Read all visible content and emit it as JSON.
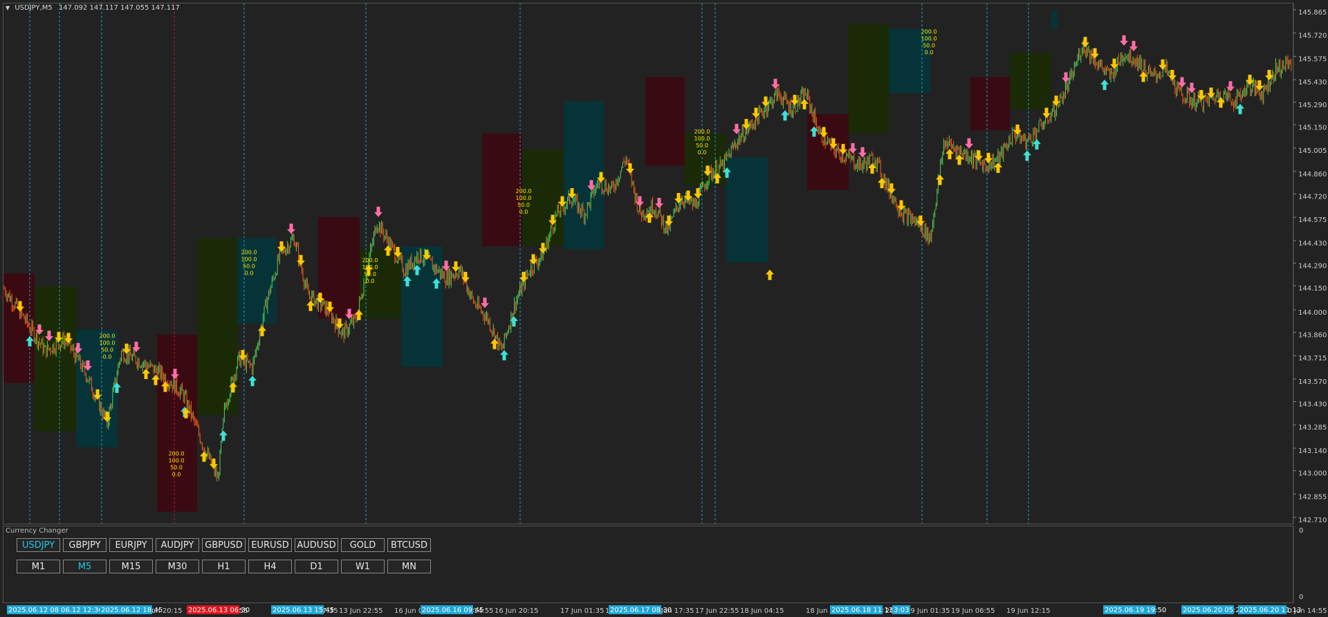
{
  "symbol": {
    "name": "USDJPY,M5",
    "ohlc": "147.092 147.117 147.055 147.117"
  },
  "colors": {
    "background": "#222222",
    "bull_candle": "#56d35a",
    "bear_candle": "#ff5a1a",
    "zone_red": "#3a0a12",
    "zone_green": "#1a2a06",
    "zone_teal": "#063338",
    "arrow_yellow": "#ffc800",
    "arrow_pink": "#ff6ea8",
    "arrow_cyan": "#3ee0d6",
    "grid_vline": "#1ea7d6",
    "accent": "#22c8e6"
  },
  "price_axis": {
    "labels": [
      "145.865",
      "145.720",
      "145.575",
      "145.430",
      "145.290",
      "145.150",
      "145.005",
      "144.860",
      "144.720",
      "144.575",
      "144.430",
      "144.290",
      "144.150",
      "144.000",
      "143.860",
      "143.715",
      "143.570",
      "143.430",
      "143.285",
      "143.140",
      "143.000",
      "142.855",
      "142.710"
    ]
  },
  "sub_axis": {
    "top": "0",
    "bottom": "0"
  },
  "panel": {
    "title": "Currency Changer"
  },
  "pairs": [
    {
      "label": "USDJPY",
      "active": true
    },
    {
      "label": "GBPJPY",
      "active": false
    },
    {
      "label": "EURJPY",
      "active": false
    },
    {
      "label": "AUDJPY",
      "active": false
    },
    {
      "label": "GBPUSD",
      "active": false
    },
    {
      "label": "EURUSD",
      "active": false
    },
    {
      "label": "AUDUSD",
      "active": false
    },
    {
      "label": "GOLD",
      "active": false
    },
    {
      "label": "BTCUSD",
      "active": false
    }
  ],
  "timeframes": [
    {
      "label": "M1",
      "active": false
    },
    {
      "label": "M5",
      "active": true
    },
    {
      "label": "M15",
      "active": false
    },
    {
      "label": "M30",
      "active": false
    },
    {
      "label": "H1",
      "active": false
    },
    {
      "label": "H4",
      "active": false
    },
    {
      "label": "D1",
      "active": false
    },
    {
      "label": "W1",
      "active": false
    },
    {
      "label": "MN",
      "active": false
    }
  ],
  "time_axis": {
    "labels": [
      "12 Jun 20:15",
      "13 Jun 06:55",
      "13 Jun 17:35",
      "13 Jun 22:55",
      "16 Jun 04:15",
      "16 Jun 14:55",
      "16 Jun 20:15",
      "17 Jun 01:35",
      "17 Jun 12:15",
      "17 Jun 17:35",
      "17 Jun 22:55",
      "18 Jun 04:15",
      "18 Jun 14:55",
      "18 Jun 20:15",
      "19 Jun 01:35",
      "19 Jun 06:55",
      "19 Jun 12:15",
      "19 Jun 22:55",
      "20 Jun 14:55"
    ],
    "highlights": [
      {
        "label": "2025.06.12 08:05",
        "color": "#1ea7d6"
      },
      {
        "label": "06.12 12:30",
        "color": "#1ea7d6"
      },
      {
        "label": "2025.06.12 18:45",
        "color": "#1ea7d6"
      },
      {
        "label": "2025.06.13 06:30",
        "color": "#e0141e"
      },
      {
        "label": "2025.06.13 15:45",
        "color": "#1ea7d6"
      },
      {
        "label": "2025.06.16 09:45",
        "color": "#1ea7d6"
      },
      {
        "label": "2025.06.17 08:30",
        "color": "#1ea7d6"
      },
      {
        "label": "2025.06.18 11:13",
        "color": "#1ea7d6"
      },
      {
        "label": "3:03",
        "color": "#1ea7d6"
      },
      {
        "label": "2025.06.19 19:50",
        "color": "#1ea7d6"
      },
      {
        "label": "2025.06.20 05:28",
        "color": "#1ea7d6"
      },
      {
        "label": "2025.06.20 11:13",
        "color": "#1ea7d6"
      }
    ]
  },
  "chart_labels": [
    "200.0",
    "100.0",
    "50.0",
    "0.0"
  ],
  "chart_data": {
    "type": "candlestick",
    "symbol": "USDJPY",
    "timeframe": "M5",
    "ylim": [
      142.71,
      145.865
    ],
    "approx_close_path": [
      [
        0,
        144.14
      ],
      [
        30,
        143.95
      ],
      [
        60,
        143.75
      ],
      [
        90,
        143.82
      ],
      [
        120,
        143.6
      ],
      [
        150,
        143.3
      ],
      [
        170,
        143.74
      ],
      [
        200,
        143.68
      ],
      [
        230,
        143.6
      ],
      [
        260,
        143.48
      ],
      [
        290,
        143.15
      ],
      [
        310,
        142.95
      ],
      [
        320,
        143.4
      ],
      [
        340,
        143.7
      ],
      [
        360,
        143.65
      ],
      [
        380,
        144.05
      ],
      [
        400,
        144.35
      ],
      [
        420,
        144.45
      ],
      [
        440,
        144.1
      ],
      [
        470,
        144.0
      ],
      [
        490,
        143.85
      ],
      [
        510,
        143.95
      ],
      [
        540,
        144.55
      ],
      [
        560,
        144.4
      ],
      [
        580,
        144.25
      ],
      [
        600,
        144.35
      ],
      [
        620,
        144.28
      ],
      [
        640,
        144.2
      ],
      [
        660,
        144.25
      ],
      [
        680,
        144.05
      ],
      [
        700,
        143.95
      ],
      [
        720,
        143.75
      ],
      [
        740,
        144.05
      ],
      [
        760,
        144.25
      ],
      [
        780,
        144.35
      ],
      [
        800,
        144.6
      ],
      [
        820,
        144.7
      ],
      [
        840,
        144.6
      ],
      [
        860,
        144.8
      ],
      [
        880,
        144.75
      ],
      [
        900,
        144.95
      ],
      [
        920,
        144.6
      ],
      [
        940,
        144.65
      ],
      [
        960,
        144.5
      ],
      [
        980,
        144.7
      ],
      [
        1000,
        144.65
      ],
      [
        1020,
        144.85
      ],
      [
        1040,
        144.9
      ],
      [
        1060,
        145.05
      ],
      [
        1080,
        145.15
      ],
      [
        1100,
        145.25
      ],
      [
        1120,
        145.35
      ],
      [
        1140,
        145.25
      ],
      [
        1160,
        145.35
      ],
      [
        1180,
        145.1
      ],
      [
        1200,
        145.0
      ],
      [
        1220,
        144.95
      ],
      [
        1240,
        144.9
      ],
      [
        1260,
        144.95
      ],
      [
        1280,
        144.75
      ],
      [
        1300,
        144.6
      ],
      [
        1320,
        144.55
      ],
      [
        1340,
        144.45
      ],
      [
        1360,
        145.05
      ],
      [
        1380,
        145.0
      ],
      [
        1400,
        144.95
      ],
      [
        1420,
        144.9
      ],
      [
        1440,
        144.95
      ],
      [
        1460,
        145.1
      ],
      [
        1480,
        145.05
      ],
      [
        1500,
        145.15
      ],
      [
        1520,
        145.25
      ],
      [
        1540,
        145.4
      ],
      [
        1560,
        145.65
      ],
      [
        1580,
        145.55
      ],
      [
        1600,
        145.45
      ],
      [
        1620,
        145.6
      ],
      [
        1640,
        145.55
      ],
      [
        1660,
        145.45
      ],
      [
        1680,
        145.5
      ],
      [
        1700,
        145.35
      ],
      [
        1720,
        145.3
      ],
      [
        1740,
        145.3
      ],
      [
        1760,
        145.35
      ],
      [
        1780,
        145.3
      ],
      [
        1800,
        145.4
      ],
      [
        1820,
        145.35
      ],
      [
        1840,
        145.5
      ],
      [
        1866,
        145.55
      ]
    ],
    "zones": [
      {
        "x0": 0,
        "x1": 45,
        "y0": 144.23,
        "y1": 143.55,
        "color": "red"
      },
      {
        "x0": 45,
        "x1": 105,
        "y0": 144.15,
        "y1": 143.25,
        "color": "green"
      },
      {
        "x0": 105,
        "x1": 165,
        "y0": 143.88,
        "y1": 143.15,
        "color": "teal"
      },
      {
        "x0": 222,
        "x1": 280,
        "y0": 143.85,
        "y1": 142.75,
        "color": "red"
      },
      {
        "x0": 280,
        "x1": 338,
        "y0": 144.45,
        "y1": 143.35,
        "color": "green"
      },
      {
        "x0": 338,
        "x1": 395,
        "y0": 144.45,
        "y1": 143.92,
        "color": "teal"
      },
      {
        "x0": 455,
        "x1": 515,
        "y0": 144.58,
        "y1": 143.95,
        "color": "red"
      },
      {
        "x0": 515,
        "x1": 575,
        "y0": 144.38,
        "y1": 143.95,
        "color": "green"
      },
      {
        "x0": 575,
        "x1": 635,
        "y0": 144.4,
        "y1": 143.65,
        "color": "teal"
      },
      {
        "x0": 692,
        "x1": 750,
        "y0": 145.1,
        "y1": 144.4,
        "color": "red"
      },
      {
        "x0": 750,
        "x1": 810,
        "y0": 145.0,
        "y1": 144.4,
        "color": "green"
      },
      {
        "x0": 810,
        "x1": 868,
        "y0": 145.3,
        "y1": 144.38,
        "color": "teal"
      },
      {
        "x0": 928,
        "x1": 985,
        "y0": 145.45,
        "y1": 144.9,
        "color": "red"
      },
      {
        "x0": 985,
        "x1": 1045,
        "y0": 145.1,
        "y1": 144.78,
        "color": "green"
      },
      {
        "x0": 1045,
        "x1": 1105,
        "y0": 144.95,
        "y1": 144.3,
        "color": "teal"
      },
      {
        "x0": 1162,
        "x1": 1222,
        "y0": 145.22,
        "y1": 144.75,
        "color": "red"
      },
      {
        "x0": 1222,
        "x1": 1280,
        "y0": 145.78,
        "y1": 145.1,
        "color": "green"
      },
      {
        "x0": 1280,
        "x1": 1340,
        "y0": 145.75,
        "y1": 145.35,
        "color": "teal"
      },
      {
        "x0": 1398,
        "x1": 1455,
        "y0": 145.45,
        "y1": 145.12,
        "color": "red"
      },
      {
        "x0": 1455,
        "x1": 1515,
        "y0": 145.6,
        "y1": 145.25,
        "color": "green"
      },
      {
        "x0": 1515,
        "x1": 1524,
        "y0": 145.865,
        "y1": 145.75,
        "color": "teal"
      }
    ]
  }
}
